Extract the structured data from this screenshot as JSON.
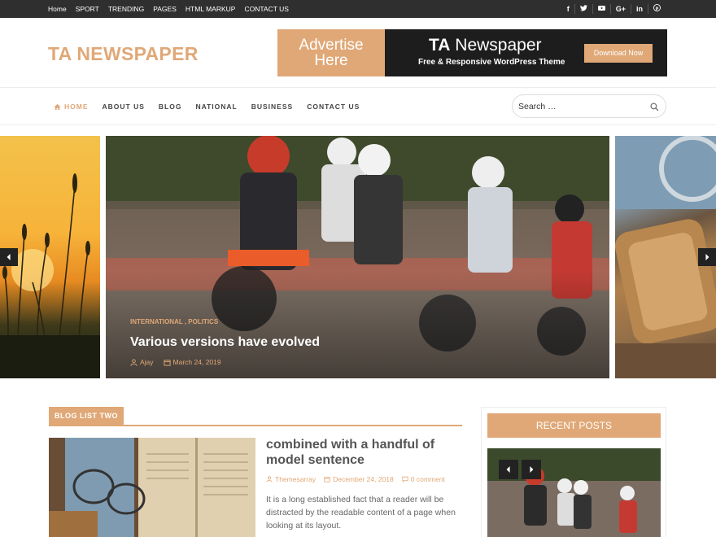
{
  "topbar": {
    "links": [
      "Home",
      "SPORT",
      "TRENDING",
      "PAGES",
      "HTML MARKUP",
      "CONTACT US"
    ],
    "social": [
      "f",
      "t",
      "yt",
      "G+",
      "in",
      "p"
    ]
  },
  "header": {
    "logo": "TA NEWSPAPER",
    "banner": {
      "left_line1": "Advertise",
      "left_line2": "Here",
      "title_bold": "TA",
      "title_rest": " Newspaper",
      "subtitle": "Free & Responsive WordPress Theme",
      "button": "Download Now"
    }
  },
  "nav": {
    "items": [
      "HOME",
      "ABOUT US",
      "BLOG",
      "NATIONAL",
      "BUSINESS",
      "CONTACT US"
    ],
    "search_placeholder": "Search …"
  },
  "slider": {
    "categories": "INTERNATIONAL ,  POLITICS",
    "title": "Various versions have evolved",
    "author": "Ajay",
    "date": "March 24, 2019"
  },
  "blog_list": {
    "section_title": "BLOG LIST TWO",
    "post": {
      "title": "combined with a handful of model sentence",
      "author": "Themesarray",
      "date": "December 24, 2018",
      "comments": "0 comment",
      "excerpt": "It is a long established fact that a reader will be distracted by the readable content of a page when looking at its layout."
    }
  },
  "sidebar": {
    "recent_title": "RECENT POSTS"
  },
  "colors": {
    "accent": "#e0a877",
    "topbar": "#2f2f2f",
    "banner_dark": "#1d1d1d"
  }
}
